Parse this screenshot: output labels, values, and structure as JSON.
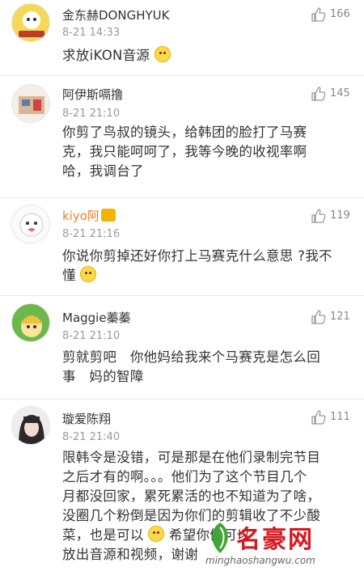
{
  "comments": [
    {
      "user": "金东赫DONGHYUK",
      "time": "8-21 14:33",
      "likes": "166",
      "text": "求放iKON音源",
      "emoji": "crying-face"
    },
    {
      "user": "阿伊斯嗝撸",
      "time": "8-21 21:10",
      "likes": "145",
      "lines": [
        "你剪了鸟叔的镜头，给韩团的脸打了马赛",
        "克，我只能呵呵了，我等今晚的收视率啊",
        "哈，我调台了"
      ]
    },
    {
      "user": "kiyo阿",
      "time": "8-21 21:16",
      "likes": "119",
      "lines": [
        "你说你剪掉还好你打上马赛克什么意思 ?我不",
        "懂"
      ],
      "badge": "crown-badge",
      "emoji": "smile-face"
    },
    {
      "user": "Maggie蓁蓁",
      "time": "8-21 21:10",
      "likes": "121",
      "lines": [
        "剪就剪吧   你他妈给我来个马赛克是怎么回",
        "事   妈的智障"
      ]
    },
    {
      "user": "璇爱陈翔",
      "time": "8-21 21:40",
      "likes": "111",
      "lines": [
        "限韩令是没错，可是那是在他们录制完节目",
        "之后才有的啊。。。他们为了这个节目几个",
        "月都没回家，累死累活的也不知道为了啥，",
        "没圈几个粉倒是因为你们的剪辑收了不少酸",
        "菜，也是可以",
        "希望你们可以",
        "放出音源和视频，谢谢"
      ]
    }
  ],
  "watermark": {
    "brand": "名豪网",
    "url": "minghaoshangwu.com"
  }
}
